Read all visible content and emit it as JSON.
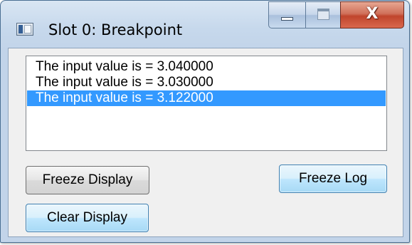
{
  "window": {
    "title": "Slot 0: Breakpoint",
    "icon": "app-window-icon",
    "caption_buttons": {
      "minimize": "minimize-icon",
      "maximize": "maximize-icon",
      "close_label": "X"
    }
  },
  "log": {
    "items": [
      {
        "text": "The input value is = 3.040000",
        "selected": false
      },
      {
        "text": "The input value is = 3.030000",
        "selected": false
      },
      {
        "text": "The input value is = 3.122000",
        "selected": true
      }
    ],
    "selection_color": "#3399ff"
  },
  "buttons": {
    "freeze_display": "Freeze Display",
    "freeze_log": "Freeze Log",
    "clear_display": "Clear Display"
  },
  "colors": {
    "window_frame": "#c2d4e9",
    "close_button": "#c0452c",
    "focused_button": "#a7d9f5"
  }
}
